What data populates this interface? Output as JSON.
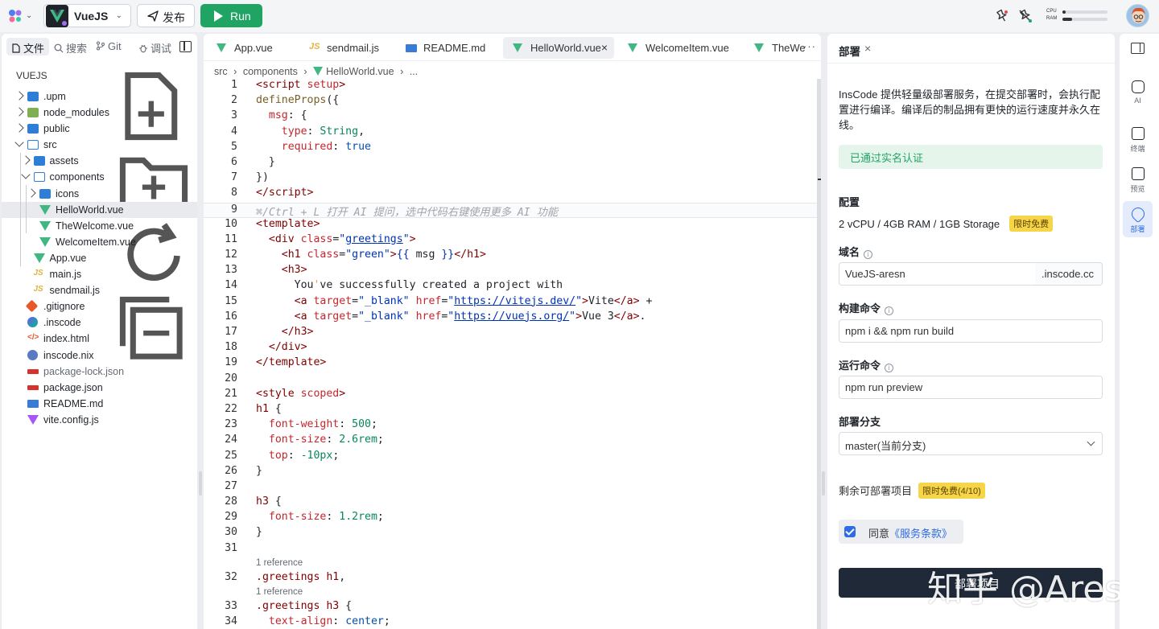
{
  "topbar": {
    "project_name": "VueJS",
    "publish_label": "发布",
    "run_label": "Run",
    "cpu_label": "CPU",
    "ram_label": "RAM",
    "cpu_usage": 0.08,
    "ram_usage": 0.22
  },
  "sidebar": {
    "tabs": [
      {
        "label": "文件"
      },
      {
        "label": "搜索"
      },
      {
        "label": "Git"
      },
      {
        "label": "调试"
      }
    ],
    "explorer_title": "VUEJS",
    "tree": [
      {
        "name": ".upm",
        "kind": "folder",
        "depth": 0,
        "expanded": false
      },
      {
        "name": "node_modules",
        "kind": "folder-npm",
        "depth": 0,
        "expanded": false
      },
      {
        "name": "public",
        "kind": "folder",
        "depth": 0,
        "expanded": false
      },
      {
        "name": "src",
        "kind": "folder-open",
        "depth": 0,
        "expanded": true
      },
      {
        "name": "assets",
        "kind": "folder",
        "depth": 1,
        "expanded": false
      },
      {
        "name": "components",
        "kind": "folder-open",
        "depth": 1,
        "expanded": true
      },
      {
        "name": "icons",
        "kind": "folder",
        "depth": 2,
        "expanded": false
      },
      {
        "name": "HelloWorld.vue",
        "kind": "vue",
        "depth": 2,
        "selected": true
      },
      {
        "name": "TheWelcome.vue",
        "kind": "vue",
        "depth": 2
      },
      {
        "name": "WelcomeItem.vue",
        "kind": "vue",
        "depth": 2
      },
      {
        "name": "App.vue",
        "kind": "vue",
        "depth": 1
      },
      {
        "name": "main.js",
        "kind": "js",
        "depth": 1
      },
      {
        "name": "sendmail.js",
        "kind": "js",
        "depth": 1
      },
      {
        "name": ".gitignore",
        "kind": "git",
        "depth": 0
      },
      {
        "name": ".inscode",
        "kind": "inscode",
        "depth": 0
      },
      {
        "name": "index.html",
        "kind": "html",
        "depth": 0
      },
      {
        "name": "inscode.nix",
        "kind": "nix",
        "depth": 0
      },
      {
        "name": "package-lock.json",
        "kind": "json",
        "depth": 0,
        "dim": true
      },
      {
        "name": "package.json",
        "kind": "json",
        "depth": 0
      },
      {
        "name": "README.md",
        "kind": "md",
        "depth": 0
      },
      {
        "name": "vite.config.js",
        "kind": "vite",
        "depth": 0
      }
    ]
  },
  "editor": {
    "tabs": [
      {
        "label": "App.vue",
        "kind": "vue"
      },
      {
        "label": "sendmail.js",
        "kind": "js"
      },
      {
        "label": "README.md",
        "kind": "md"
      },
      {
        "label": "HelloWorld.vue",
        "kind": "vue",
        "active": true
      },
      {
        "label": "WelcomeItem.vue",
        "kind": "vue"
      },
      {
        "label": "TheWe",
        "kind": "vue"
      }
    ],
    "breadcrumb": [
      "src",
      "components",
      "HelloWorld.vue",
      "..."
    ],
    "reference_label": "1 reference",
    "lines": [
      {
        "n": "1",
        "html": "<span class='c-tag'>&lt;script</span> <span class='c-attr'>setup</span><span class='c-tag'>&gt;</span>"
      },
      {
        "n": "2",
        "html": "<span class='c-fn'>defineProps</span>({"
      },
      {
        "n": "3",
        "html": "  <span class='c-prop'>msg</span>: {"
      },
      {
        "n": "4",
        "html": "    <span class='c-prop'>type</span>: <span class='c-num'>String</span>,"
      },
      {
        "n": "5",
        "html": "    <span class='c-prop'>required</span>: <span class='c-val'>true</span>"
      },
      {
        "n": "6",
        "html": "  }"
      },
      {
        "n": "7",
        "html": "})"
      },
      {
        "n": "8",
        "html": "<span class='c-tag'>&lt;/script&gt;</span>"
      },
      {
        "n": "9",
        "html": "<span class='c-cm'>⌘/Ctrl + L 打开 AI 提问，选中代码右键使用更多 AI 功能</span>",
        "hl": true
      },
      {
        "n": "10",
        "html": "<span class='c-tag'>&lt;template&gt;</span>"
      },
      {
        "n": "11",
        "html": "  <span class='c-tag'>&lt;div</span> <span class='c-attr'>class</span>=<span class='c-str'>\"<u>greetings</u>\"</span><span class='c-tag'>&gt;</span>"
      },
      {
        "n": "12",
        "html": "    <span class='c-tag'>&lt;h1</span> <span class='c-attr'>class</span>=<span class='c-str'>\"green\"</span><span class='c-tag'>&gt;</span><span class='c-mus'>{{</span> msg <span class='c-mus'>}}</span><span class='c-tag'>&lt;/h1&gt;</span>"
      },
      {
        "n": "13",
        "html": "    <span class='c-tag'>&lt;h3&gt;</span>"
      },
      {
        "n": "14",
        "html": "      You<span style='color:#e3a33c'>'</span>ve successfully created a project with"
      },
      {
        "n": "15",
        "html": "      <span class='c-tag'>&lt;a</span> <span class='c-attr'>target</span>=<span class='c-str'>\"_blank\"</span> <span class='c-attr'>href</span>=<span class='c-str'>\"<span class='c-link'>https://vitejs.dev/</span>\"</span><span class='c-tag'>&gt;</span>Vite<span class='c-tag'>&lt;/a&gt;</span> +"
      },
      {
        "n": "16",
        "html": "      <span class='c-tag'>&lt;a</span> <span class='c-attr'>target</span>=<span class='c-str'>\"_blank\"</span> <span class='c-attr'>href</span>=<span class='c-str'>\"<span class='c-link'>https://vuejs.org/</span>\"</span><span class='c-tag'>&gt;</span>Vue 3<span class='c-tag'>&lt;/a&gt;</span>."
      },
      {
        "n": "17",
        "html": "    <span class='c-tag'>&lt;/h3&gt;</span>"
      },
      {
        "n": "18",
        "html": "  <span class='c-tag'>&lt;/div&gt;</span>"
      },
      {
        "n": "19",
        "html": "<span class='c-tag'>&lt;/template&gt;</span>"
      },
      {
        "n": "20",
        "html": ""
      },
      {
        "n": "21",
        "html": "<span class='c-tag'>&lt;style</span> <span class='c-attr'>scoped</span><span class='c-tag'>&gt;</span>"
      },
      {
        "n": "22",
        "html": "<span class='c-tag'>h1</span> {"
      },
      {
        "n": "23",
        "html": "  <span class='c-prop'>font-weight</span>: <span class='c-num'>500</span>;"
      },
      {
        "n": "24",
        "html": "  <span class='c-prop'>font-size</span>: <span class='c-num'>2.6rem</span>;"
      },
      {
        "n": "25",
        "html": "  <span class='c-prop'>top</span>: <span class='c-num'>-10px</span>;"
      },
      {
        "n": "26",
        "html": "}"
      },
      {
        "n": "27",
        "html": ""
      },
      {
        "n": "28",
        "html": "<span class='c-tag'>h3</span> {"
      },
      {
        "n": "29",
        "html": "  <span class='c-prop'>font-size</span>: <span class='c-num'>1.2rem</span>;"
      },
      {
        "n": "30",
        "html": "}"
      },
      {
        "n": "31",
        "html": ""
      },
      {
        "n": "32",
        "html": "<span class='c-tag'>.greetings h1</span>,",
        "ref": true
      },
      {
        "n": "33",
        "html": "<span class='c-tag'>.greetings h3</span> {",
        "ref": true
      },
      {
        "n": "34",
        "html": "  <span class='c-prop'>text-align</span>: <span class='c-val'>center</span>;"
      }
    ]
  },
  "deploy": {
    "title": "部署",
    "intro": "InsCode 提供轻量级部署服务，在提交部署时，会执行配置进行编译。编译后的制品拥有更快的运行速度并永久在线。",
    "verified": "已通过实名认证",
    "config_title": "配置",
    "spec": "2 vCPU / 4GB RAM / 1GB Storage",
    "free_badge": "限时免费",
    "domain_title": "域名",
    "domain_value": "VueJS-aresn",
    "domain_suffix": ".inscode.cc",
    "build_title": "构建命令",
    "build_value": "npm i && npm run build",
    "run_title": "运行命令",
    "run_value": "npm run preview",
    "branch_title": "部署分支",
    "branch_value": "master(当前分支)",
    "remain_label": "剩余可部署项目",
    "remain_badge": "限时免费(4/10)",
    "agree_prefix": "同意",
    "agree_link": "《服务条款》",
    "deploy_button": "部署项目",
    "watermark": "知乎 @Aresn"
  },
  "rail": {
    "items": [
      {
        "label": "AI",
        "icon": "robot-icon"
      },
      {
        "label": "终端",
        "icon": "terminal-icon"
      },
      {
        "label": "预览",
        "icon": "monitor-icon"
      },
      {
        "label": "部署",
        "icon": "rocket-icon",
        "active": true
      }
    ]
  },
  "colors": {
    "accent": "#2e6be6",
    "run": "#1fa463",
    "vue": "#41b883"
  }
}
